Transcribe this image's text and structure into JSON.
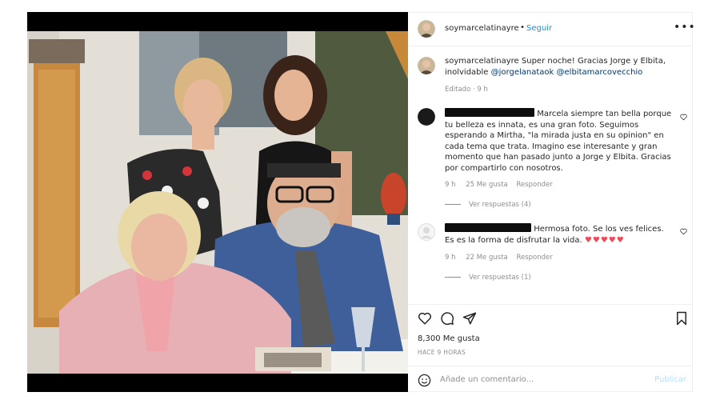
{
  "post": {
    "username": "soymarcelatinayre",
    "follow_label": "Seguir",
    "more_icon": "more-options-icon"
  },
  "caption": {
    "username": "soymarcelatinayre",
    "text": "Super noche! Gracias Jorge y Elbita, inolvidable",
    "mention1": "@jorgelanataok",
    "mention2": "@elbitamarcovecchio",
    "meta": "Editado · 9 h"
  },
  "comments": [
    {
      "text": "Marcela siempre tan bella porque tu belleza es innata, es una gran foto. Seguimos esperando a Mirtha, \"la mirada justa en su opinion\" en cada tema que trata. Imagino ese interesante y gran momento que han pasado junto a Jorge y Elbita. Gracias por compartirlo con nosotros.",
      "time": "9 h",
      "likes": "25 Me gusta",
      "reply": "Responder",
      "view_replies": "Ver respuestas (4)"
    },
    {
      "text": "Hermosa foto. Se los ves felices. Es es la forma de disfrutar la vida. ♥♥♥♥♥",
      "time": "9 h",
      "likes": "22 Me gusta",
      "reply": "Responder",
      "view_replies": "Ver respuestas (1)"
    }
  ],
  "actions": {
    "icons": [
      "heart-icon",
      "comment-icon",
      "share-icon",
      "bookmark-icon"
    ],
    "likes": "8,300 Me gusta",
    "time_ago": "HACE 9 HORAS"
  },
  "footer": {
    "placeholder": "Añade un comentario...",
    "publish_label": "Publicar"
  },
  "colors": {
    "link": "#00376b",
    "follow": "#0095f6",
    "publish_disabled": "#b2dffc",
    "meta": "#8e8e8e",
    "heart_red": "#ed4956"
  }
}
